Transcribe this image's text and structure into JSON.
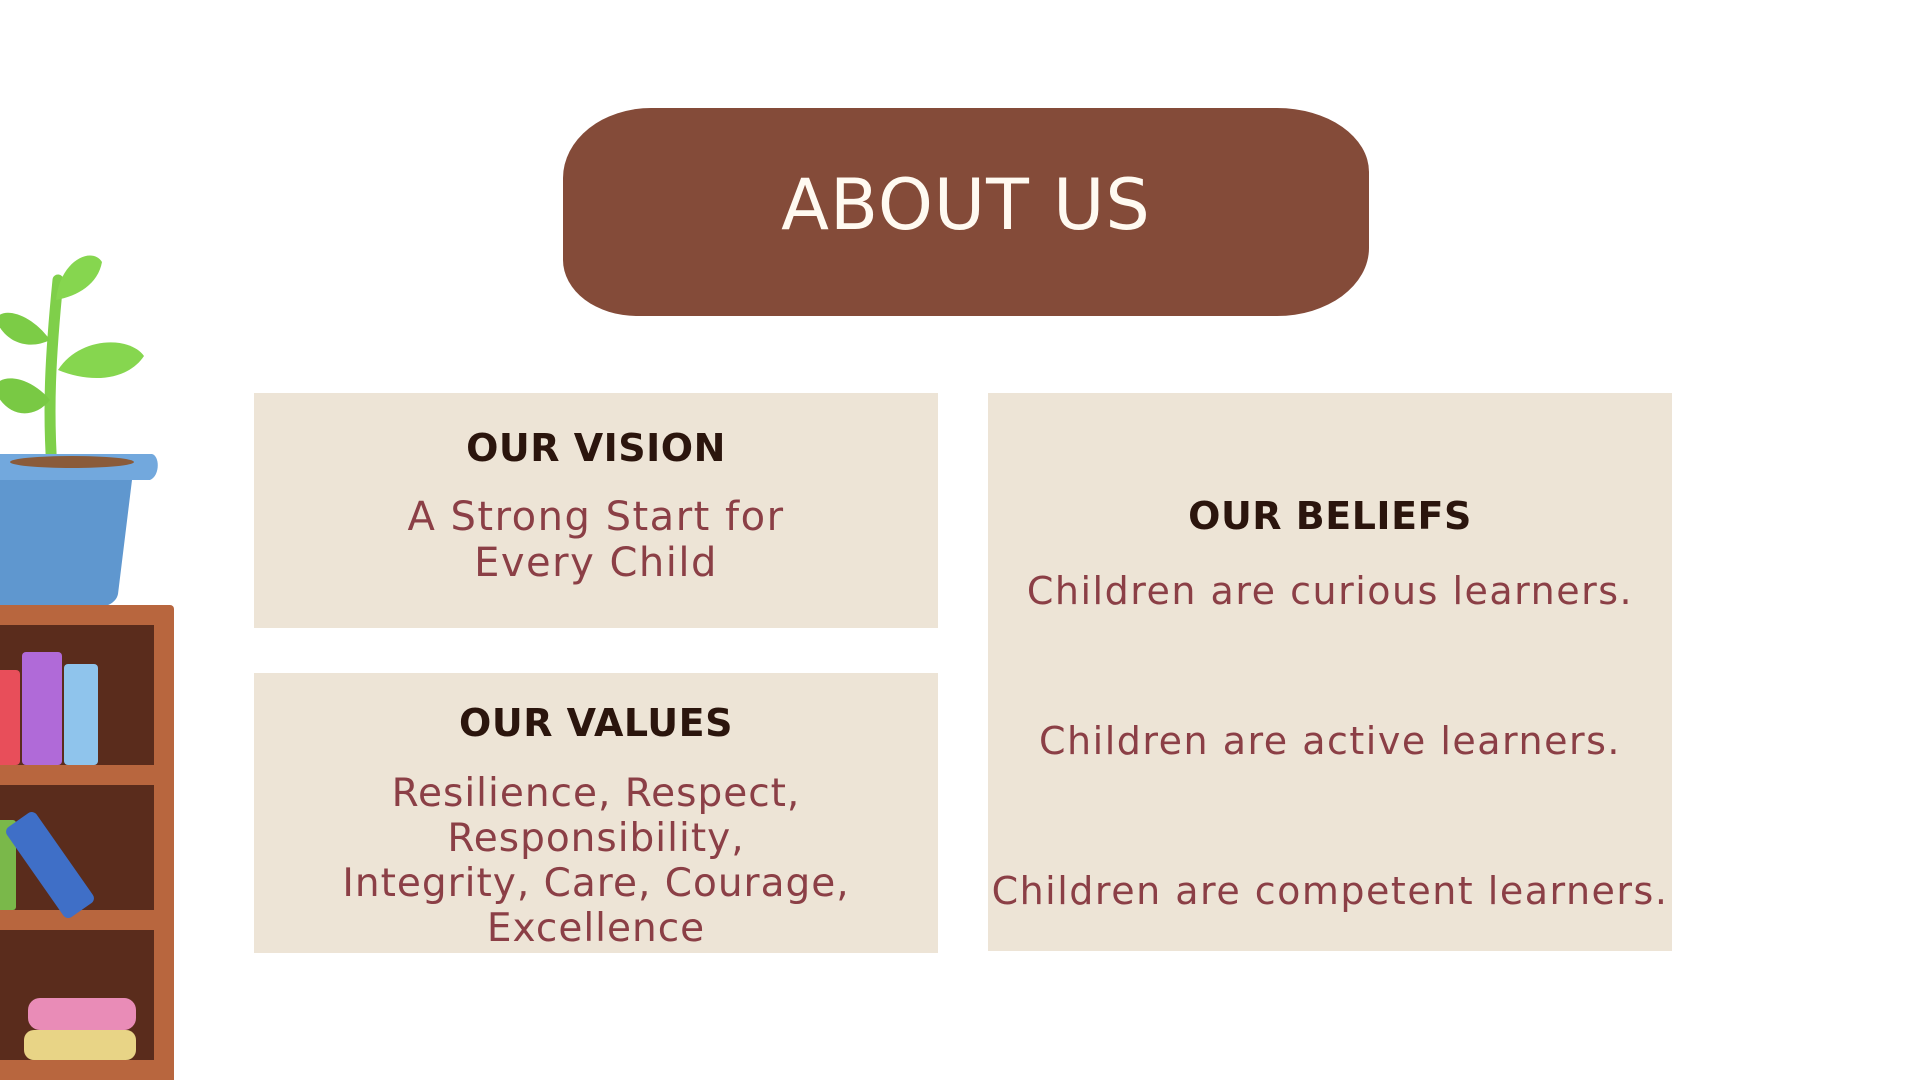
{
  "title": "ABOUT US",
  "vision": {
    "heading": "OUR VISION",
    "lines": [
      "A Strong Start for",
      "Every Child"
    ]
  },
  "values": {
    "heading": "OUR VALUES",
    "lines": [
      "Resilience, Respect, Responsibility,",
      "Integrity, Care, Courage,",
      "Excellence"
    ]
  },
  "beliefs": {
    "heading": "OUR BELIEFS",
    "items": [
      "Children are curious learners.",
      "Children are active learners.",
      "Children are competent learners."
    ]
  },
  "colors": {
    "title_background": "#844b39",
    "card_background": "#ede4d6",
    "heading_text": "#2b150d",
    "body_text": "#8b3f46"
  },
  "icons": [
    "potted-plant-illustration",
    "bookshelf-illustration"
  ]
}
